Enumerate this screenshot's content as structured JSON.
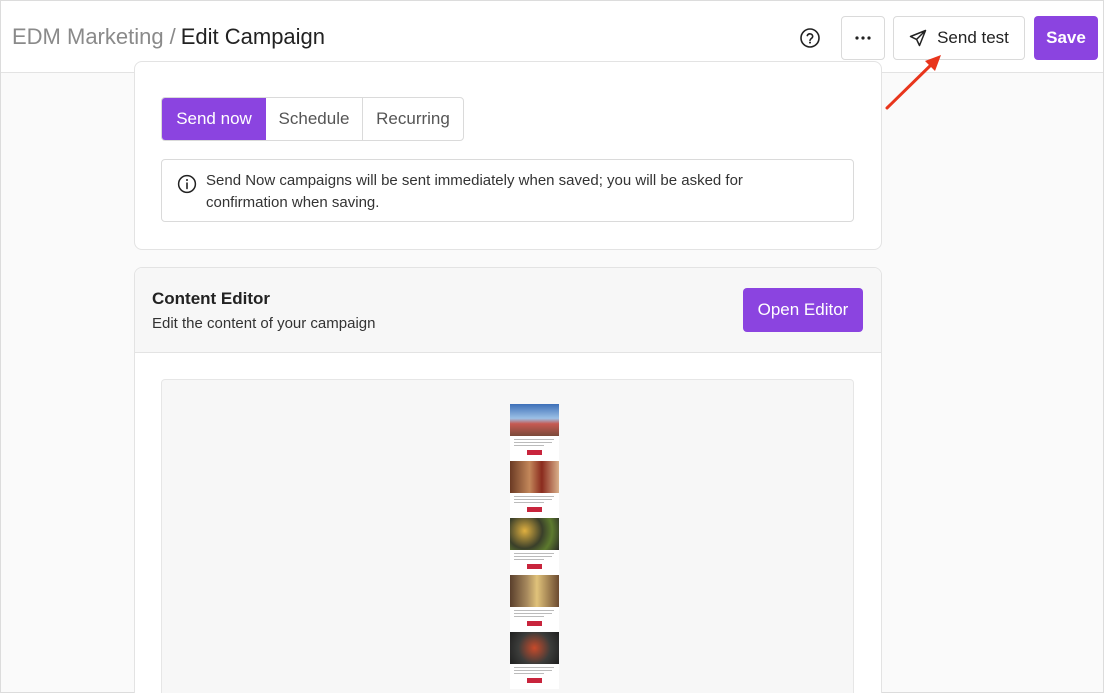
{
  "header": {
    "breadcrumb_parent": "EDM Marketing",
    "breadcrumb_separator": "/",
    "page_title": "Edit Campaign",
    "help_icon": "question-circle-icon",
    "more_icon": "ellipsis-icon",
    "more_label": "···",
    "send_test_icon": "paper-plane-icon",
    "send_test_label": "Send test",
    "save_label": "Save"
  },
  "schedule": {
    "options": [
      "Send now",
      "Schedule",
      "Recurring"
    ],
    "selected": "Send now",
    "info_icon": "info-icon",
    "info_text": "Send Now campaigns will be sent immediately when saved; you will be asked for confirmation when saving."
  },
  "content_editor": {
    "title": "Content Editor",
    "subtitle": "Edit the content of your campaign",
    "open_editor_label": "Open Editor"
  },
  "colors": {
    "accent": "#8b44e0",
    "annotation_arrow": "#e8351c",
    "email_button": "#c8243c"
  }
}
